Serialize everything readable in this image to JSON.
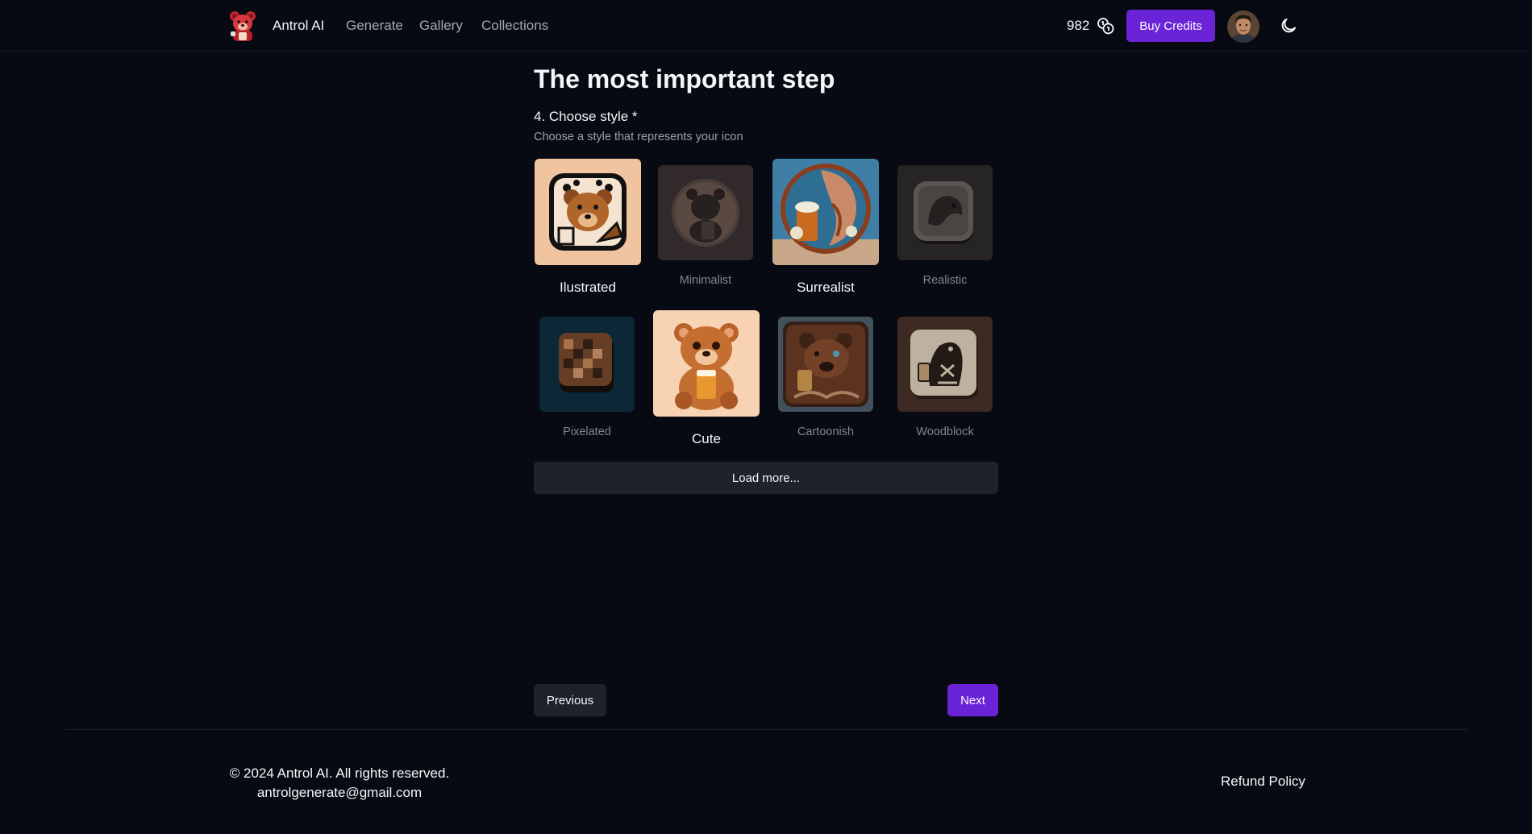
{
  "header": {
    "brand": "Antrol AI",
    "nav": [
      "Generate",
      "Gallery",
      "Collections"
    ],
    "credits": "982",
    "buy_label": "Buy Credits"
  },
  "main": {
    "title": "The most important step",
    "step_label": "4. Choose style *",
    "step_desc": "Choose a style that represents your icon",
    "styles": [
      {
        "label": "Ilustrated",
        "selected": true
      },
      {
        "label": "Minimalist",
        "selected": false
      },
      {
        "label": "Surrealist",
        "selected": true
      },
      {
        "label": "Realistic",
        "selected": false
      },
      {
        "label": "Pixelated",
        "selected": false
      },
      {
        "label": "Cute",
        "selected": true
      },
      {
        "label": "Cartoonish",
        "selected": false
      },
      {
        "label": "Woodblock",
        "selected": false
      }
    ],
    "load_more": "Load more...",
    "previous": "Previous",
    "next": "Next"
  },
  "footer": {
    "copyright": "© 2024 Antrol AI. All rights reserved.",
    "email": "antrolgenerate@gmail.com",
    "refund": "Refund Policy"
  },
  "colors": {
    "background": "#070a12",
    "accent": "#6b23d8",
    "button_secondary": "#1d222c"
  }
}
